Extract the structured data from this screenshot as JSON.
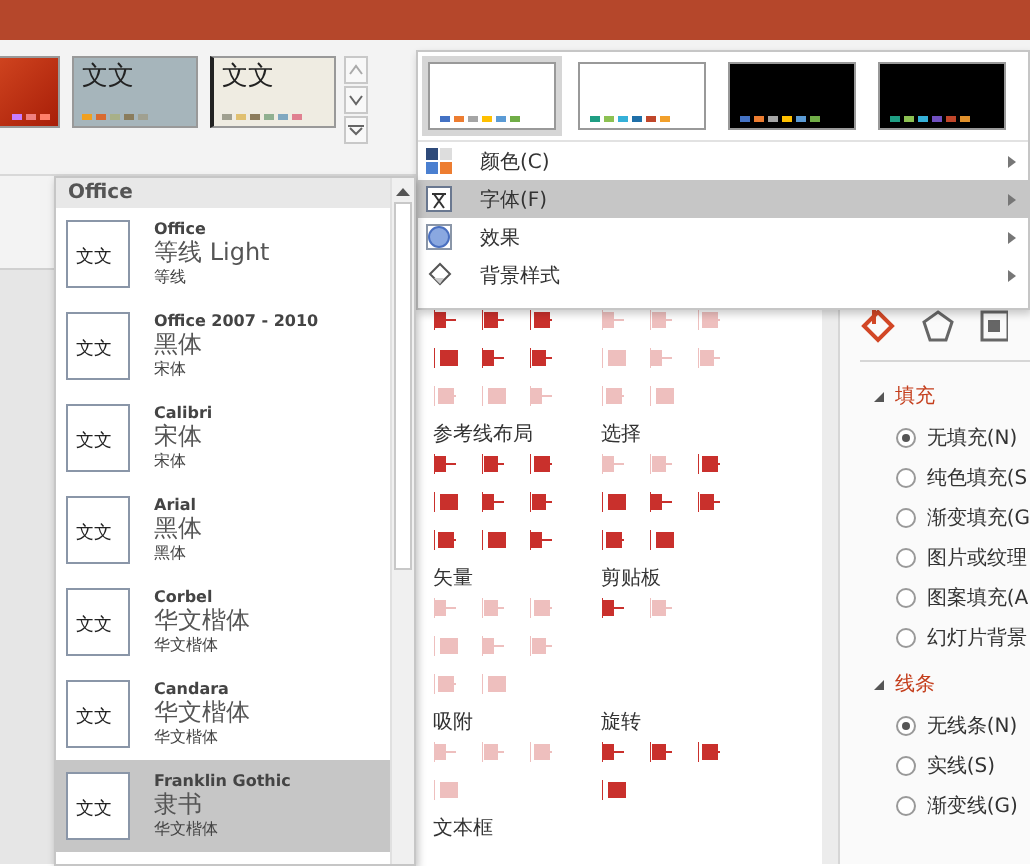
{
  "themes": [
    {
      "swatches": [
        {
          "color": "#c77dff"
        },
        {
          "color": "#f08080"
        },
        {
          "color": "#ff7f6a"
        }
      ]
    },
    {
      "sample": "文文",
      "swatches": [
        {
          "color": "#f0a020"
        },
        {
          "color": "#d86a30"
        },
        {
          "color": "#a8b088"
        },
        {
          "color": "#8a7c5c"
        },
        {
          "color": "#a0a090"
        }
      ]
    },
    {
      "sample": "文文",
      "swatches": [
        {
          "color": "#a0a090"
        },
        {
          "color": "#e0c070"
        },
        {
          "color": "#8c7c5c"
        },
        {
          "color": "#90b090"
        },
        {
          "color": "#80a8c0"
        },
        {
          "color": "#e08090"
        }
      ]
    }
  ],
  "variants": [
    {
      "selected": true,
      "dark": false,
      "swatches": [
        {
          "color": "#4472c4"
        },
        {
          "color": "#ed7d31"
        },
        {
          "color": "#a5a5a5"
        },
        {
          "color": "#ffc000"
        },
        {
          "color": "#5b9bd5"
        },
        {
          "color": "#70ad47"
        }
      ]
    },
    {
      "selected": false,
      "dark": false,
      "swatches": [
        {
          "color": "#1f9e83"
        },
        {
          "color": "#8cc152"
        },
        {
          "color": "#35b0d8"
        },
        {
          "color": "#1f6fa8"
        },
        {
          "color": "#c0462a"
        },
        {
          "color": "#f2a02b"
        }
      ]
    },
    {
      "selected": false,
      "dark": true,
      "swatches": [
        {
          "color": "#4472c4"
        },
        {
          "color": "#ed7d31"
        },
        {
          "color": "#a5a5a5"
        },
        {
          "color": "#ffc000"
        },
        {
          "color": "#5b9bd5"
        },
        {
          "color": "#70ad47"
        }
      ]
    },
    {
      "selected": false,
      "dark": true,
      "swatches": [
        {
          "color": "#1f9e83"
        },
        {
          "color": "#8cc152"
        },
        {
          "color": "#35b0d8"
        },
        {
          "color": "#7050c0"
        },
        {
          "color": "#c0462a"
        },
        {
          "color": "#e0902b"
        }
      ]
    }
  ],
  "variant_menu": [
    {
      "label": "颜色(C)",
      "selected": false
    },
    {
      "label": "字体(F)",
      "selected": true
    },
    {
      "label": "效果",
      "selected": false
    },
    {
      "label": "背景样式",
      "selected": false
    }
  ],
  "font_menu": {
    "header": "Office",
    "items": [
      {
        "name": "Office",
        "heading": "等线 Light",
        "body": "等线",
        "sample": "文文",
        "selected": false
      },
      {
        "name": "Office 2007 - 2010",
        "heading": "黑体",
        "body": "宋体",
        "sample": "文文",
        "selected": false
      },
      {
        "name": "Calibri",
        "heading": "宋体",
        "body": "宋体",
        "sample": "文文",
        "selected": false
      },
      {
        "name": "Arial",
        "heading": "黑体",
        "body": "黑体",
        "sample": "文文",
        "selected": false
      },
      {
        "name": "Corbel",
        "heading": "华文楷体",
        "body": "华文楷体",
        "sample": "文文",
        "selected": false
      },
      {
        "name": "Candara",
        "heading": "华文楷体",
        "body": "华文楷体",
        "sample": "文文",
        "selected": false
      },
      {
        "name": "Franklin Gothic",
        "heading": "隶书",
        "body": "华文楷体",
        "sample": "文文",
        "selected": true
      }
    ]
  },
  "tools": [
    {
      "groups": [
        {
          "icons": [
            {
              "disabled": false
            },
            {
              "disabled": false
            },
            {
              "disabled": false
            },
            {
              "disabled": false
            },
            {
              "disabled": false
            },
            {
              "disabled": false
            },
            {
              "disabled": true
            },
            {
              "disabled": true
            },
            {
              "disabled": true
            }
          ]
        },
        {
          "icons": [
            {
              "disabled": true
            },
            {
              "disabled": true
            },
            {
              "disabled": true
            },
            {
              "disabled": true
            },
            {
              "disabled": true
            },
            {
              "disabled": true
            },
            {
              "disabled": true
            },
            {
              "disabled": true
            }
          ]
        }
      ]
    },
    {
      "groups": [
        {
          "title": "参考线布局",
          "icons": [
            {
              "disabled": false
            },
            {
              "disabled": false
            },
            {
              "disabled": false
            },
            {
              "disabled": false
            },
            {
              "disabled": false
            },
            {
              "disabled": false
            },
            {
              "disabled": false
            },
            {
              "disabled": false
            },
            {
              "disabled": false
            }
          ]
        },
        {
          "title": "选择",
          "icons": [
            {
              "disabled": true
            },
            {
              "disabled": true
            },
            {
              "disabled": false
            },
            {
              "disabled": false
            },
            {
              "disabled": false
            },
            {
              "disabled": false
            },
            {
              "disabled": false
            },
            {
              "disabled": false
            }
          ]
        }
      ]
    },
    {
      "groups": [
        {
          "title": "矢量",
          "icons": [
            {
              "disabled": true
            },
            {
              "disabled": true
            },
            {
              "disabled": true
            },
            {
              "disabled": true
            },
            {
              "disabled": true
            },
            {
              "disabled": true
            },
            {
              "disabled": true
            },
            {
              "disabled": true
            }
          ]
        },
        {
          "title": "剪贴板",
          "icons": [
            {
              "disabled": false
            },
            {
              "disabled": true
            }
          ]
        }
      ]
    },
    {
      "groups": [
        {
          "title": "吸附",
          "icons": [
            {
              "disabled": true
            },
            {
              "disabled": true
            },
            {
              "disabled": true
            },
            {
              "disabled": true
            }
          ]
        },
        {
          "title": "旋转",
          "icons": [
            {
              "disabled": false
            },
            {
              "disabled": false
            },
            {
              "disabled": false
            },
            {
              "disabled": false
            }
          ]
        }
      ]
    },
    {
      "groups": [
        {
          "title": "文本框"
        }
      ]
    }
  ],
  "format_pane": {
    "tabs": [
      {
        "kind": "fill",
        "selected": true
      },
      {
        "kind": "effects",
        "selected": false
      },
      {
        "kind": "layout",
        "selected": false
      }
    ],
    "sections": [
      {
        "title": "填充",
        "expanded": true,
        "options": [
          {
            "label": "无填充(N)",
            "selected": true
          },
          {
            "label": "纯色填充(S",
            "selected": false
          },
          {
            "label": "渐变填充(G",
            "selected": false
          },
          {
            "label": "图片或纹理",
            "selected": false
          },
          {
            "label": "图案填充(A",
            "selected": false
          },
          {
            "label": "幻灯片背景",
            "selected": false
          }
        ]
      },
      {
        "title": "线条",
        "expanded": true,
        "options": [
          {
            "label": "无线条(N)",
            "selected": true
          },
          {
            "label": "实线(S)",
            "selected": false
          },
          {
            "label": "渐变线(G)",
            "selected": false
          }
        ]
      }
    ]
  }
}
